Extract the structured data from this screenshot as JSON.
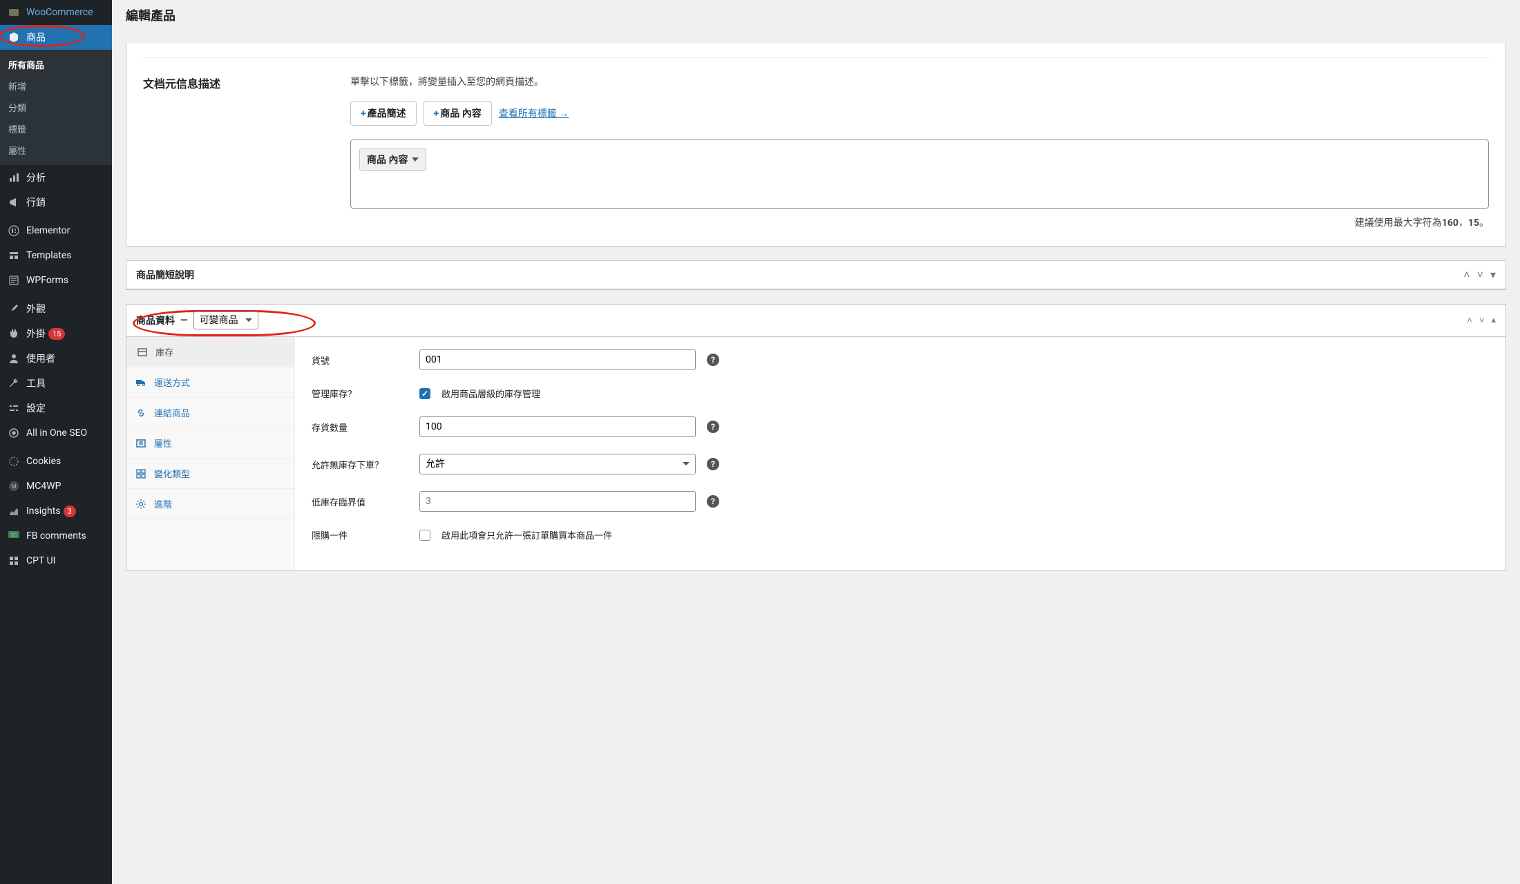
{
  "page": {
    "title": "編輯產品"
  },
  "sidebar": {
    "items": [
      {
        "label": "WooCommerce",
        "icon": "woo"
      },
      {
        "label": "商品",
        "icon": "box",
        "current": true
      },
      {
        "label": "分析",
        "icon": "chart"
      },
      {
        "label": "行銷",
        "icon": "megaphone"
      },
      {
        "label": "Elementor",
        "icon": "elementor"
      },
      {
        "label": "Templates",
        "icon": "templates"
      },
      {
        "label": "WPForms",
        "icon": "wpforms"
      },
      {
        "label": "外觀",
        "icon": "brush"
      },
      {
        "label": "外掛",
        "icon": "plugin",
        "badge": "15"
      },
      {
        "label": "使用者",
        "icon": "user"
      },
      {
        "label": "工具",
        "icon": "wrench"
      },
      {
        "label": "設定",
        "icon": "sliders"
      },
      {
        "label": "All in One SEO",
        "icon": "aioseo"
      },
      {
        "label": "Cookies",
        "icon": "cookies"
      },
      {
        "label": "MC4WP",
        "icon": "mc4wp"
      },
      {
        "label": "Insights",
        "icon": "insights",
        "badge": "3"
      },
      {
        "label": "FB comments",
        "icon": "fbc"
      },
      {
        "label": "CPT UI",
        "icon": "cptui"
      }
    ],
    "products_submenu": [
      "所有商品",
      "新增",
      "分類",
      "標籤",
      "屬性"
    ]
  },
  "meta": {
    "heading": "文档元信息描述",
    "hint": "單擊以下標籤，將變量插入至您的網頁描述。",
    "btn1": "產品簡述",
    "btn2": "商品 內容",
    "link": "查看所有標籤 →",
    "chip": "商品 內容",
    "counter_prefix": "建議使用最大字符為",
    "counter_max": "160",
    "counter_sep": "，",
    "counter_current": "15",
    "counter_suffix": "。"
  },
  "short_desc": {
    "title": "商品簡短說明"
  },
  "product_data": {
    "title": "商品資料",
    "type_selected": "可變商品",
    "tabs": [
      {
        "label": "庫存",
        "icon": "inventory",
        "active": true
      },
      {
        "label": "運送方式",
        "icon": "truck"
      },
      {
        "label": "連結商品",
        "icon": "link"
      },
      {
        "label": "屬性",
        "icon": "list"
      },
      {
        "label": "變化類型",
        "icon": "variations"
      },
      {
        "label": "進階",
        "icon": "gear"
      }
    ],
    "fields": {
      "sku_label": "貨號",
      "sku_value": "001",
      "manage_label": "管理庫存？",
      "manage_text": "啟用商品層級的庫存管理",
      "manage_checked": true,
      "qty_label": "存貨數量",
      "qty_value": "100",
      "backorder_label": "允許無庫存下單？",
      "backorder_value": "允許",
      "threshold_label": "低庫存臨界值",
      "threshold_placeholder": "3",
      "limit_label": "限購一件",
      "limit_text": "啟用此項會只允許一張訂單購買本商品一件",
      "limit_checked": false
    }
  }
}
